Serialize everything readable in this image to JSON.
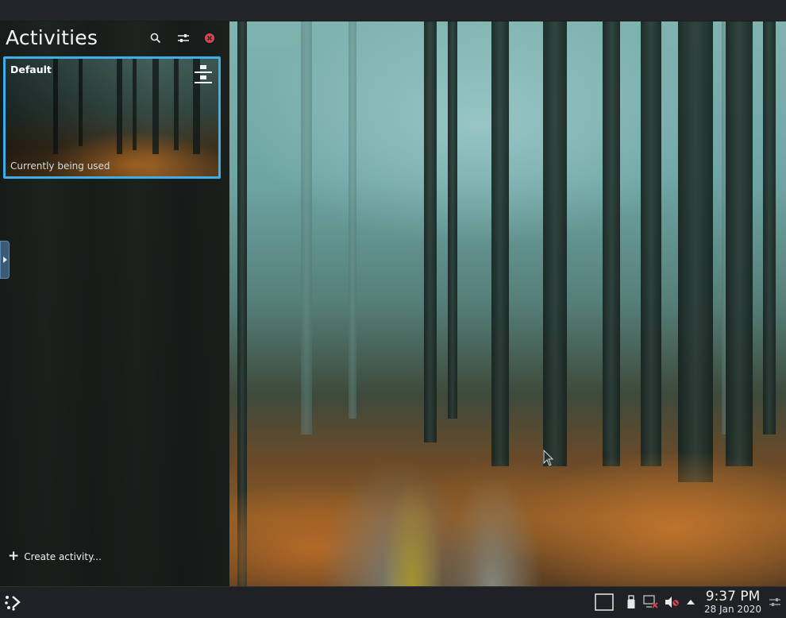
{
  "activities": {
    "title": "Activities",
    "items": [
      {
        "name": "Default",
        "status": "Currently being used",
        "active": true
      }
    ],
    "create_label": "Create activity..."
  },
  "header_icons": {
    "search": "search-icon",
    "filter": "filter-icon",
    "close": "close-icon"
  },
  "colors": {
    "accent": "#3daee9",
    "close_red": "#da4453",
    "panel_bg": "#1f2124"
  },
  "taskbar": {
    "clock": {
      "time": "9:37 PM",
      "date": "28 Jan 2020"
    },
    "tray_icons": [
      "show-desktop-icon",
      "usb-device-icon",
      "network-disconnected-icon",
      "volume-muted-icon",
      "tray-expand-icon",
      "panel-settings-icon"
    ]
  }
}
